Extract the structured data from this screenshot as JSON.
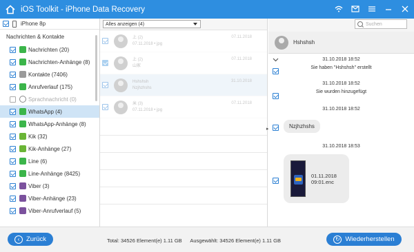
{
  "app": {
    "title": "iOS Toolkit - iPhone Data Recovery"
  },
  "sidebar": {
    "device": "iPhone 8p",
    "section": "Nachrichten & Kontakte",
    "items": [
      {
        "label": "Nachrichten (20)",
        "icon": "message-icon",
        "color": "#3bb54a"
      },
      {
        "label": "Nachrichten-Anhänge (8)",
        "icon": "message-icon",
        "color": "#3bb54a"
      },
      {
        "label": "Kontakte (7406)",
        "icon": "contacts-icon",
        "color": "#9a9a9a"
      },
      {
        "label": "Anrufverlauf (175)",
        "icon": "phone-icon",
        "color": "#3bb54a"
      },
      {
        "label": "Sprachnachricht (0)",
        "icon": "voicemail-icon",
        "color": "#888888"
      },
      {
        "label": "WhatsApp (4)",
        "icon": "whatsapp-icon",
        "color": "#3bb54a"
      },
      {
        "label": "WhatsApp-Anhänge (8)",
        "icon": "whatsapp-icon",
        "color": "#3bb54a"
      },
      {
        "label": "Kik (32)",
        "icon": "kik-icon",
        "color": "#6ab536"
      },
      {
        "label": "Kik-Anhänge (27)",
        "icon": "kik-icon",
        "color": "#6ab536"
      },
      {
        "label": "Line (6)",
        "icon": "line-icon",
        "color": "#3bb54a"
      },
      {
        "label": "Line-Anhänge (8425)",
        "icon": "line-icon",
        "color": "#3bb54a"
      },
      {
        "label": "Viber (3)",
        "icon": "viber-icon",
        "color": "#7b519d"
      },
      {
        "label": "Viber-Anhänge (23)",
        "icon": "viber-icon",
        "color": "#7b519d"
      },
      {
        "label": "Viber-Anrufverlauf (5)",
        "icon": "viber-icon",
        "color": "#7b519d"
      }
    ]
  },
  "list": {
    "filter": "Alles anzeigen (4)",
    "rows": [
      {
        "line1": "上 (2)",
        "line2": "07.11.2018 • jpg",
        "date": "07.11.2018"
      },
      {
        "line1": "上 (2)",
        "line2": "山家",
        "date": "07.11.2018"
      },
      {
        "line1": "Hshshsh",
        "line2": "Nzjhzhshs",
        "date": "31.10.2018"
      },
      {
        "line1": "米 (3)",
        "line2": "07.11.2018 • jpg",
        "date": "07.11.2018"
      }
    ]
  },
  "search": {
    "placeholder": "Suchen"
  },
  "conversation": {
    "name": "Hshshsh",
    "ts1": "31.10.2018 18:52",
    "sys1": "Sie haben \"Hshshsh\" erstellt",
    "ts2": "31.10.2018 18:52",
    "sys2": "Sie wurden hinzugefügt",
    "ts3": "31.10.2018 18:52",
    "msg1": "Nzjhzhshs",
    "ts4": "31.10.2018 18:53",
    "media_line1": "01.11.2018",
    "media_line2": "09:01.enc"
  },
  "footer": {
    "back": "Zurück",
    "total": "Total: 34526 Element(e) 1.11 GB",
    "selected": "Ausgewählt: 34526 Element(e) 1.11 GB",
    "restore": "Wiederherstellen"
  },
  "colors": {
    "accent": "#2b7fd4",
    "titlebar": "#2e8ee0",
    "selection": "#cfe4f6"
  }
}
